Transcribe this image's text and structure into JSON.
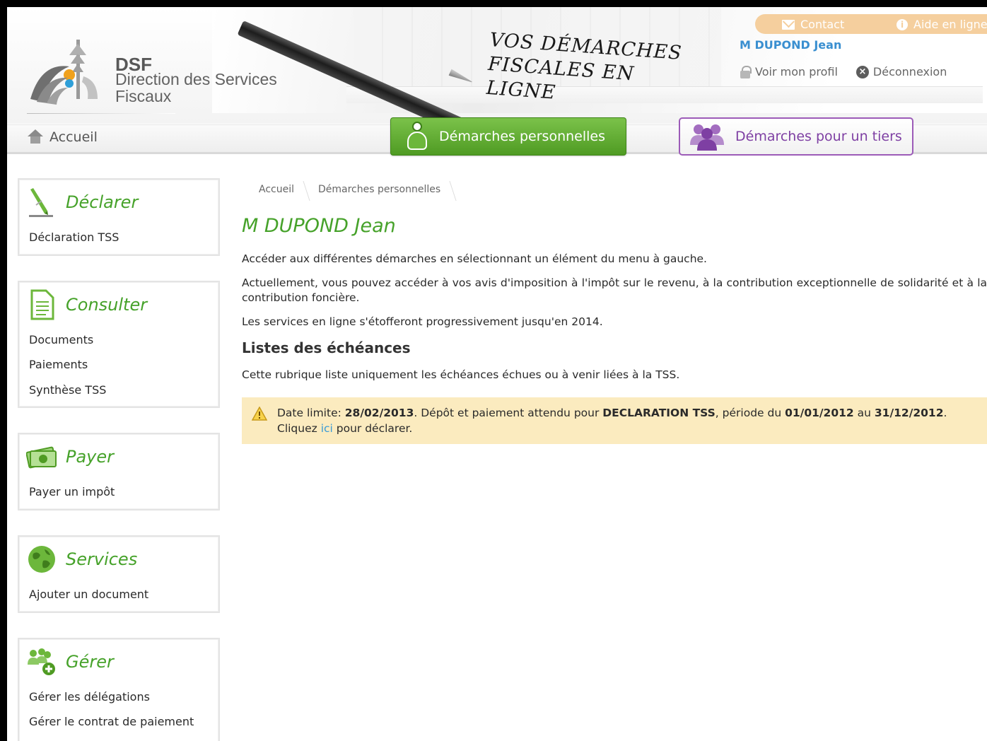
{
  "header": {
    "logo_abbr": "DSF",
    "logo_name_line1": "Direction des Services",
    "logo_name_line2": "Fiscaux",
    "slogan_line1": "VOS DÉMARCHES",
    "slogan_line2": "FISCALES EN LIGNE",
    "contact_label": "Contact",
    "help_label": "Aide en ligne",
    "user_name": "M DUPOND Jean",
    "profile_label": "Voir mon profil",
    "logout_label": "Déconnexion"
  },
  "nav": {
    "home_label": "Accueil",
    "tab_personal": "Démarches personnelles",
    "tab_third_party": "Démarches pour un tiers"
  },
  "sidebar": {
    "sections": [
      {
        "title": "Déclarer",
        "items": [
          "Déclaration TSS"
        ]
      },
      {
        "title": "Consulter",
        "items": [
          "Documents",
          "Paiements",
          "Synthèse TSS"
        ]
      },
      {
        "title": "Payer",
        "items": [
          "Payer un impôt"
        ]
      },
      {
        "title": "Services",
        "items": [
          "Ajouter un document"
        ]
      },
      {
        "title": "Gérer",
        "items": [
          "Gérer les délégations",
          "Gérer le contrat de paiement"
        ]
      }
    ]
  },
  "main": {
    "breadcrumb": [
      "Accueil",
      "Démarches personnelles"
    ],
    "title": "M DUPOND Jean",
    "intro": "Accéder aux différentes démarches en sélectionnant un élément du menu à gauche.",
    "info": "Actuellement, vous pouvez accéder à vos avis d'imposition à l'impôt sur le revenu, à la contribution exceptionnelle de solidarité et à la contribution foncière.",
    "progress_note": "Les services en ligne s'étofferont progressivement jusqu'en 2014.",
    "section_title": "Listes des échéances",
    "section_desc": "Cette rubrique liste uniquement les échéances échues ou à venir liées à la TSS.",
    "alert": {
      "prefix": "Date limite: ",
      "date": "28/02/2013",
      "middle": ". Dépôt et paiement attendu pour ",
      "declaration": "DECLARATION TSS",
      "period_prefix": ", période du ",
      "period_start": "01/01/2012",
      "period_mid": " au ",
      "period_end": "31/12/2012",
      "period_suffix": ".",
      "line2_prefix": "Cliquez ",
      "link": "ici",
      "line2_suffix": " pour déclarer."
    }
  },
  "colors": {
    "green": "#46a22a",
    "purple": "#7e3fa3",
    "orange": "#f5cf9e",
    "alert_bg": "#fbebbf",
    "link": "#3a9bd6"
  }
}
